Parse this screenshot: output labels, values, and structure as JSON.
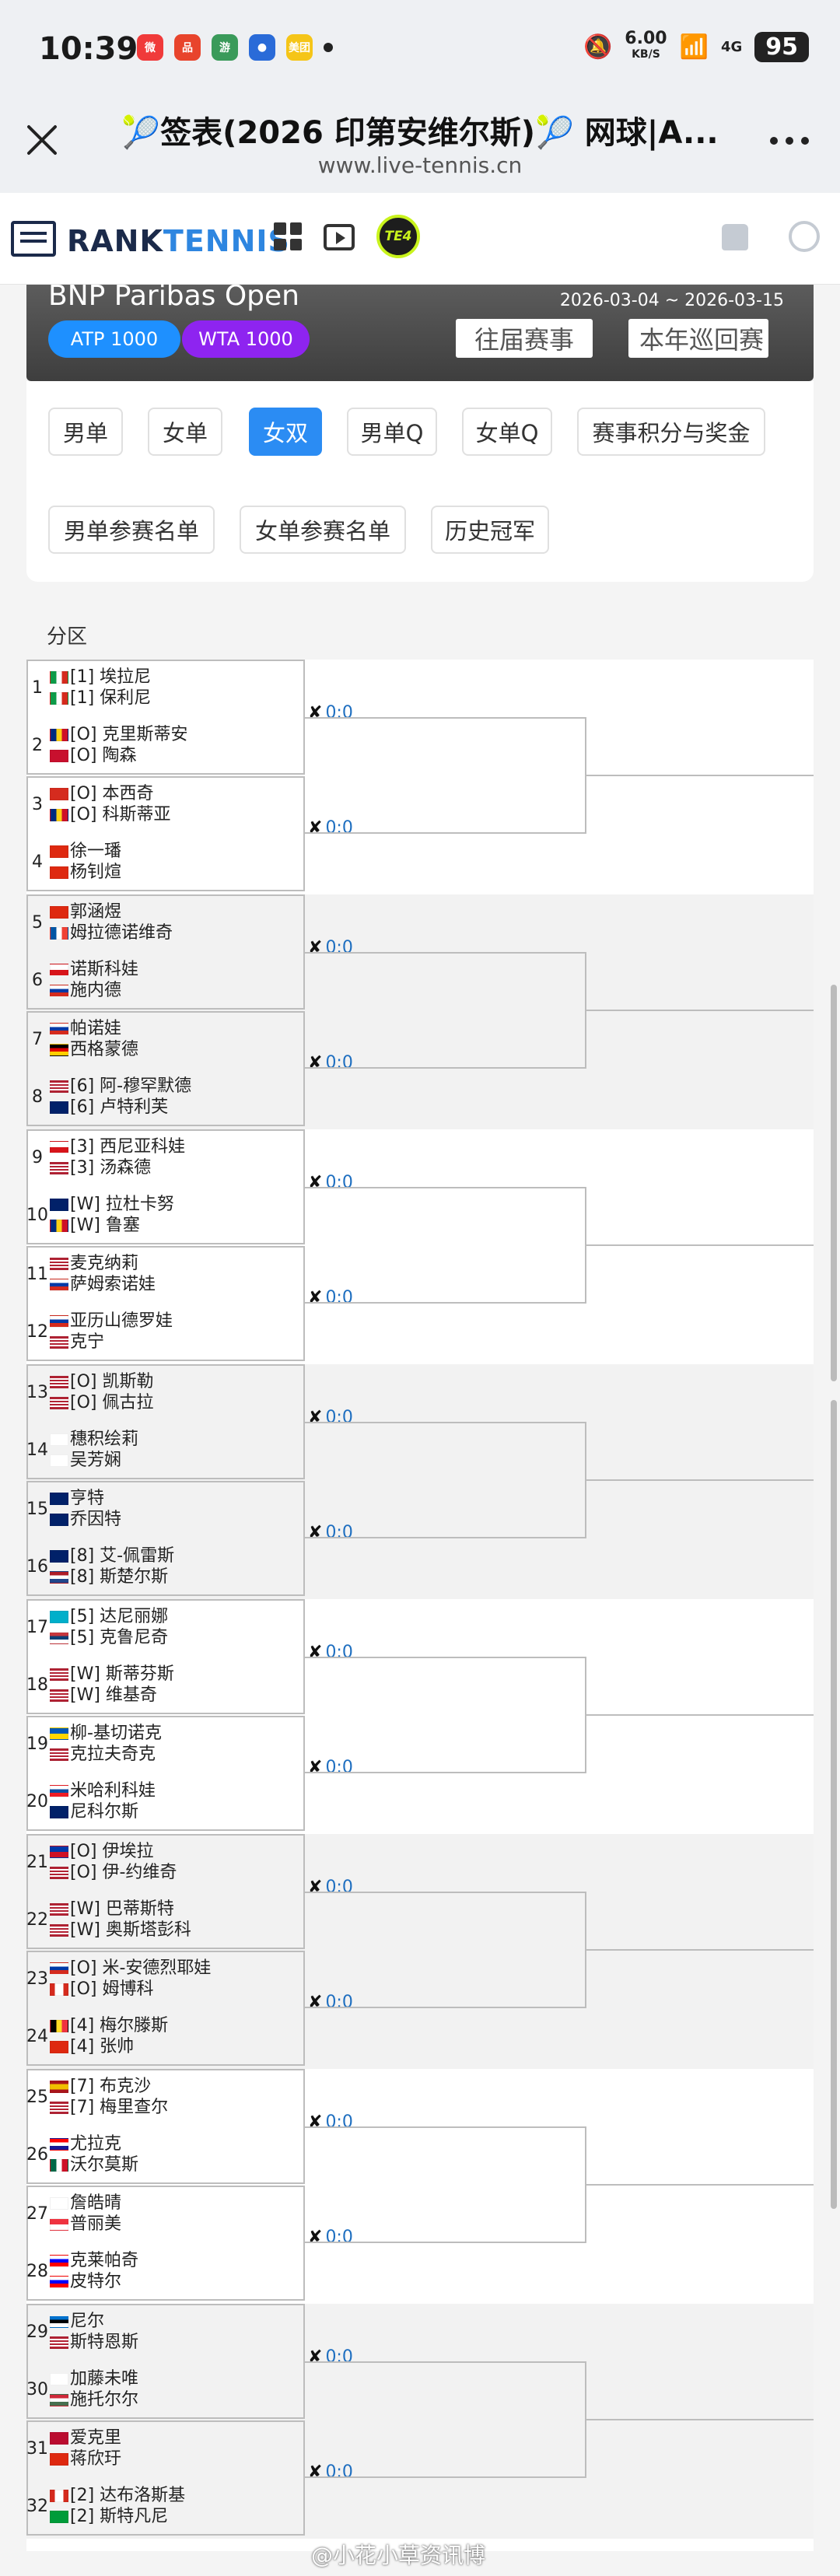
{
  "status_bar": {
    "time": "10:39",
    "speed": "6.00",
    "speed_unit": "KB/S",
    "network": "4G",
    "battery": "95"
  },
  "status_apps": [
    {
      "name": "weibo",
      "color": "#f03a3a",
      "label": "微"
    },
    {
      "name": "app-red",
      "color": "#e8442c",
      "label": "品"
    },
    {
      "name": "app-game",
      "color": "#3a9a5a",
      "label": "游"
    },
    {
      "name": "app-blue",
      "color": "#2a6bd8",
      "label": "●"
    },
    {
      "name": "meituan",
      "color": "#f5c518",
      "label": "美团"
    }
  ],
  "browser": {
    "title": "🎾签表(2026 印第安维尔斯)🎾 网球|A...",
    "url": "www.live-tennis.cn"
  },
  "site": {
    "logo_a": "RANK",
    "logo_b": "TENNIS",
    "te4": "TE4"
  },
  "banner": {
    "name": "BNP Paribas Open",
    "dates": "2026-03-04 ~ 2026-03-15",
    "atp": "ATP 1000",
    "wta": "WTA 1000",
    "past": "往届赛事",
    "tour": "本年巡回赛"
  },
  "tabs": [
    "男单",
    "女单",
    "女双",
    "男单Q",
    "女单Q",
    "赛事积分与奖金",
    "男单参赛名单",
    "女单参赛名单",
    "历史冠军"
  ],
  "active_tab": "女双",
  "draw": {
    "header": "分区",
    "score": "0:0",
    "slots": [
      {
        "num": "1",
        "p": [
          [
            "it",
            "[1] 埃拉尼"
          ],
          [
            "it",
            "[1] 保利尼"
          ]
        ]
      },
      {
        "num": "2",
        "p": [
          [
            "ro",
            "[O] 克里斯蒂安"
          ],
          [
            "dk",
            "[O] 陶森"
          ]
        ]
      },
      {
        "num": "3",
        "p": [
          [
            "ch",
            "[O] 本西奇"
          ],
          [
            "ro",
            "[O] 科斯蒂亚"
          ]
        ]
      },
      {
        "num": "4",
        "p": [
          [
            "cn",
            "徐一璠"
          ],
          [
            "cn",
            "杨钊煊"
          ]
        ]
      },
      {
        "num": "5",
        "p": [
          [
            "cn",
            "郭涵煜"
          ],
          [
            "fr",
            "姆拉德诺维奇"
          ]
        ]
      },
      {
        "num": "6",
        "p": [
          [
            "cz",
            "诺斯科娃"
          ],
          [
            "ru",
            "施内德"
          ]
        ]
      },
      {
        "num": "7",
        "p": [
          [
            "ru",
            "帕诺娃"
          ],
          [
            "de",
            "西格蒙德"
          ]
        ]
      },
      {
        "num": "8",
        "p": [
          [
            "us",
            "[6] 阿-穆罕默德"
          ],
          [
            "nz",
            "[6] 卢特利芙"
          ]
        ]
      },
      {
        "num": "9",
        "p": [
          [
            "cz",
            "[3] 西尼亚科娃"
          ],
          [
            "us",
            "[3] 汤森德"
          ]
        ]
      },
      {
        "num": "10",
        "p": [
          [
            "gb",
            "[W] 拉杜卡努"
          ],
          [
            "ro",
            "[W] 鲁塞"
          ]
        ]
      },
      {
        "num": "11",
        "p": [
          [
            "us",
            "麦克纳莉"
          ],
          [
            "ru",
            "萨姆索诺娃"
          ]
        ]
      },
      {
        "num": "12",
        "p": [
          [
            "ru",
            "亚历山德罗娃"
          ],
          [
            "us",
            "克宁"
          ]
        ]
      },
      {
        "num": "13",
        "p": [
          [
            "us",
            "[O] 凯斯勒"
          ],
          [
            "us",
            "[O] 佩古拉"
          ]
        ]
      },
      {
        "num": "14",
        "p": [
          [
            "jp",
            "穗积绘莉"
          ],
          [
            "tw",
            "吴芳娴"
          ]
        ]
      },
      {
        "num": "15",
        "p": [
          [
            "au",
            "亨特"
          ],
          [
            "au",
            "乔因特"
          ]
        ]
      },
      {
        "num": "16",
        "p": [
          [
            "au",
            "[8] 艾-佩雷斯"
          ],
          [
            "nl",
            "[8] 斯楚尔斯"
          ]
        ]
      },
      {
        "num": "17",
        "p": [
          [
            "kz",
            "[5] 达尼丽娜"
          ],
          [
            "rs",
            "[5] 克鲁尼奇"
          ]
        ]
      },
      {
        "num": "18",
        "p": [
          [
            "us",
            "[W] 斯蒂芬斯"
          ],
          [
            "us",
            "[W] 维基奇"
          ]
        ]
      },
      {
        "num": "19",
        "p": [
          [
            "ua",
            "柳-基切诺克"
          ],
          [
            "us",
            "克拉夫奇克"
          ]
        ]
      },
      {
        "num": "20",
        "p": [
          [
            "sk",
            "米哈利科娃"
          ],
          [
            "gb",
            "尼科尔斯"
          ]
        ]
      },
      {
        "num": "21",
        "p": [
          [
            "ph",
            "[O] 伊埃拉"
          ],
          [
            "us",
            "[O] 伊-约维奇"
          ]
        ]
      },
      {
        "num": "22",
        "p": [
          [
            "us",
            "[W] 巴蒂斯特"
          ],
          [
            "us",
            "[W] 奥斯塔彭科"
          ]
        ]
      },
      {
        "num": "23",
        "p": [
          [
            "ru",
            "[O] 米-安德烈耶娃"
          ],
          [
            "ca",
            "[O] 姆博科"
          ]
        ]
      },
      {
        "num": "24",
        "p": [
          [
            "be",
            "[4] 梅尔滕斯"
          ],
          [
            "cn",
            "[4] 张帅"
          ]
        ]
      },
      {
        "num": "25",
        "p": [
          [
            "es",
            "[7] 布克沙"
          ],
          [
            "us",
            "[7] 梅里查尔"
          ]
        ]
      },
      {
        "num": "26",
        "p": [
          [
            "hr",
            "尤拉克"
          ],
          [
            "mx",
            "沃尔莫斯"
          ]
        ]
      },
      {
        "num": "27",
        "p": [
          [
            "tw",
            "詹皓晴"
          ],
          [
            "sg",
            "普丽美"
          ]
        ]
      },
      {
        "num": "28",
        "p": [
          [
            "si",
            "克莱帕奇"
          ],
          [
            "si",
            "皮特尔"
          ]
        ]
      },
      {
        "num": "29",
        "p": [
          [
            "ee",
            "尼尔"
          ],
          [
            "us",
            "斯特恩斯"
          ]
        ]
      },
      {
        "num": "30",
        "p": [
          [
            "jp",
            "加藤未唯"
          ],
          [
            "hu",
            "施托尔尔"
          ]
        ]
      },
      {
        "num": "31",
        "p": [
          [
            "no",
            "爱克里"
          ],
          [
            "cn",
            "蒋欣玗"
          ]
        ]
      },
      {
        "num": "32",
        "p": [
          [
            "ca",
            "[2] 达布洛斯基"
          ],
          [
            "br",
            "[2] 斯特凡尼"
          ]
        ]
      }
    ]
  },
  "watermark": "@小花小草资讯博"
}
